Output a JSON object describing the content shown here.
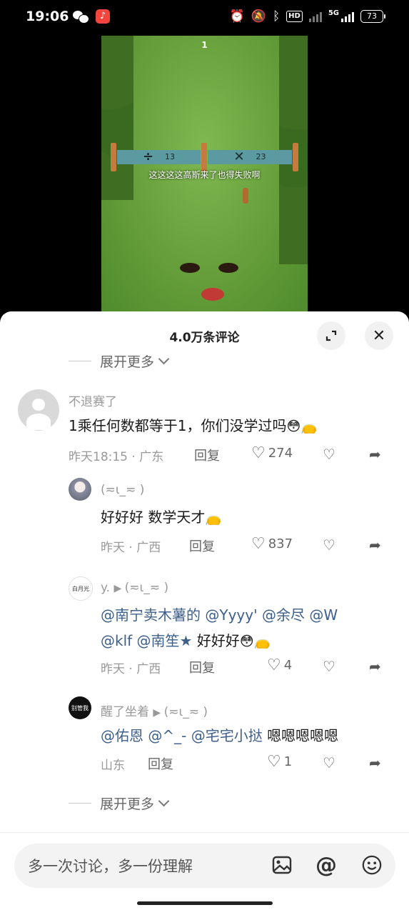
{
  "status_bar": {
    "time": "19:06",
    "net_label": "5G",
    "hd_label": "HD",
    "battery": "73"
  },
  "video": {
    "score": "1",
    "gate_left_op": "÷",
    "gate_left_val": "13",
    "gate_right_op": "✕",
    "gate_right_val": "23",
    "caption": "这这这这高斯来了也得失败啊"
  },
  "sheet": {
    "title": "4.0万条评论",
    "expand_more_top": "展开更多",
    "expand_more_bottom": "展开更多"
  },
  "comments": [
    {
      "user": "不退赛了",
      "text": "1乘任何数都等于1，你们没学过吗",
      "time_loc": "昨天18:15 · 广东",
      "reply": "回复",
      "likes": "274"
    }
  ],
  "replies": [
    {
      "user": "(≂ι_≂ )",
      "text": "好好好 数学天才",
      "time_loc": "昨天 · 广西",
      "reply": "回复",
      "likes": "837"
    },
    {
      "avatar_text": "白月光",
      "user": "y.",
      "reply_to": "(≂ι_≂ )",
      "mention1": "@南宁卖木薯的",
      "mention2": "@Yyyy'",
      "mention3": "@余尽",
      "mention4": "@W",
      "mention5": "@klf",
      "mention6": "@南笙★",
      "text_tail": "好好好",
      "time_loc": "昨天 · 广西",
      "reply": "回复",
      "likes": "4"
    },
    {
      "avatar_text": "别管我",
      "user": "醒了坐着",
      "reply_to": "(≂ι_≂ )",
      "mention1": "@佑恩",
      "mention2": "@^_-",
      "mention3": "@宅宅小挞",
      "text_tail": "嗯嗯嗯嗯嗯",
      "time_loc": "山东",
      "reply": "回复",
      "likes": "1"
    }
  ],
  "input": {
    "placeholder": "多一次讨论，多一份理解"
  },
  "icons": {
    "like": "heart-outline-icon",
    "dislike": "broken-heart-icon",
    "share": "share-arrow-icon",
    "image": "image-icon",
    "at": "at-icon",
    "emoji": "smile-icon"
  }
}
